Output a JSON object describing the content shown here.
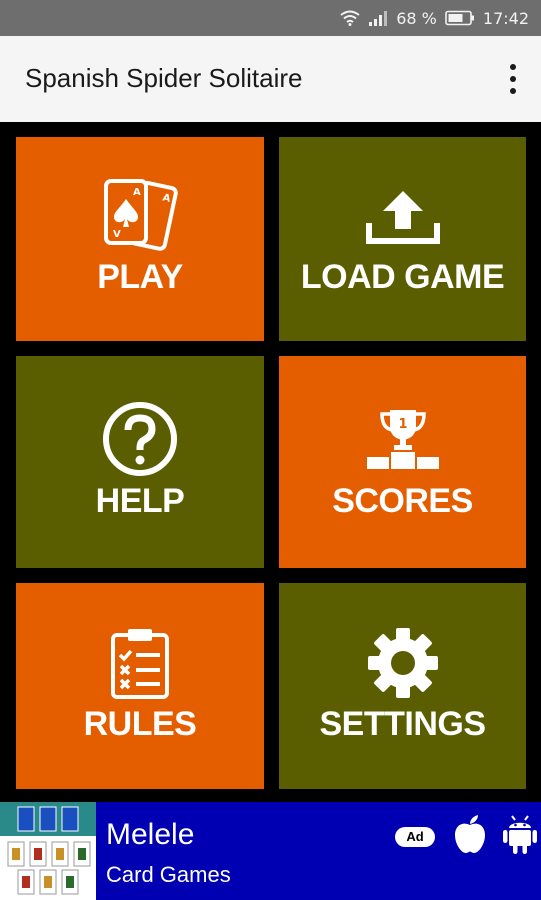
{
  "status_bar": {
    "battery": "68 %",
    "time": "17:42"
  },
  "app_bar": {
    "title": "Spanish Spider Solitaire",
    "menu_icon": "overflow-menu-icon"
  },
  "menu": [
    {
      "id": "play",
      "label": "PLAY",
      "icon": "cards-icon",
      "color": "#e45e00"
    },
    {
      "id": "load-game",
      "label": "LOAD GAME",
      "icon": "upload-icon",
      "color": "#5a5e00"
    },
    {
      "id": "help",
      "label": "HELP",
      "icon": "question-icon",
      "color": "#5a5e00"
    },
    {
      "id": "scores",
      "label": "SCORES",
      "icon": "trophy-podium-icon",
      "color": "#e45e00"
    },
    {
      "id": "rules",
      "label": "RULES",
      "icon": "clipboard-checklist-icon",
      "color": "#e45e00"
    },
    {
      "id": "settings",
      "label": "SETTINGS",
      "icon": "gear-icon",
      "color": "#5a5e00"
    }
  ],
  "ad": {
    "title": "Melele",
    "subtitle": "Card Games",
    "badge": "Ad",
    "background": "#0000b2",
    "icons": [
      "apple-icon",
      "android-icon"
    ]
  }
}
